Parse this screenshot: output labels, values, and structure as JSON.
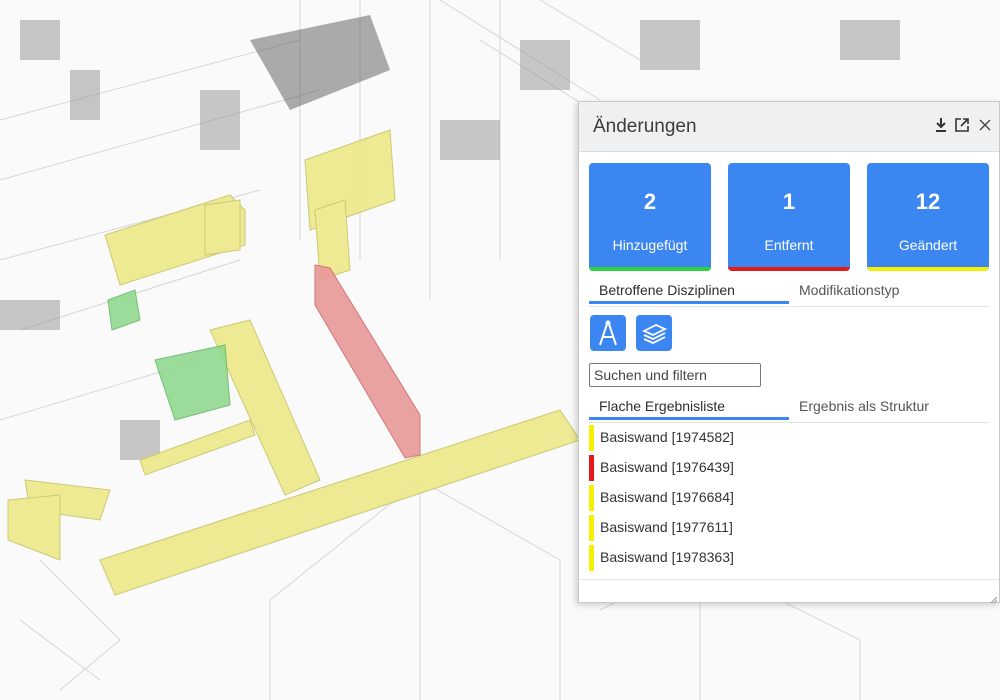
{
  "panel": {
    "title": "Änderungen"
  },
  "stats": [
    {
      "count": "2",
      "label": "Hinzugefügt",
      "color": "#31d13b"
    },
    {
      "count": "1",
      "label": "Entfernt",
      "color": "#e31b1b"
    },
    {
      "count": "12",
      "label": "Geändert",
      "color": "#f6f000"
    }
  ],
  "tabs_top": [
    "Betroffene Disziplinen",
    "Modifikationstyp"
  ],
  "search": {
    "placeholder": "Suchen und filtern"
  },
  "tabs_results": [
    "Flache Ergebnisliste",
    "Ergebnis als Struktur"
  ],
  "results": [
    {
      "label": "Basiswand [1974582]",
      "status_color": "#f6f000"
    },
    {
      "label": "Basiswand [1976439]",
      "status_color": "#e31b1b"
    },
    {
      "label": "Basiswand [1976684]",
      "status_color": "#f6f000"
    },
    {
      "label": "Basiswand [1977611]",
      "status_color": "#f6f000"
    },
    {
      "label": "Basiswand [1978363]",
      "status_color": "#f6f000"
    }
  ],
  "icons": {
    "download": "download-icon",
    "popout": "popout-icon",
    "close": "close-icon",
    "architecture": "compass-icon",
    "structure": "layers-icon"
  },
  "accent_color": "#3b86f0"
}
